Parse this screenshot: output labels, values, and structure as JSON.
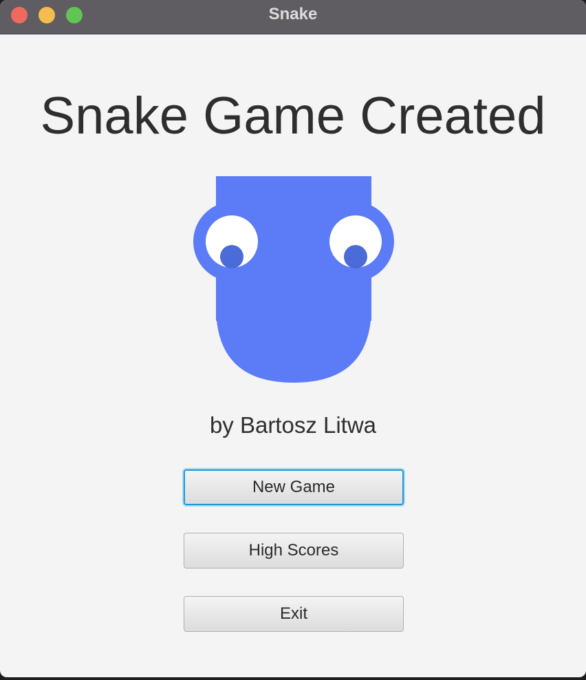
{
  "window": {
    "title": "Snake",
    "controls": [
      "close-button",
      "minimize-button",
      "zoom-button"
    ]
  },
  "main": {
    "heading": "Snake Game Created",
    "logo_icon": "snake-head-icon",
    "author": "by Bartosz Litwa"
  },
  "buttons": {
    "new_game": "New Game",
    "high_scores": "High Scores",
    "exit": "Exit"
  },
  "colors": {
    "titlebar": "#5f5d61",
    "background": "#f4f4f4",
    "snake": "#5b7bf7",
    "focus": "#1c9ad6"
  }
}
